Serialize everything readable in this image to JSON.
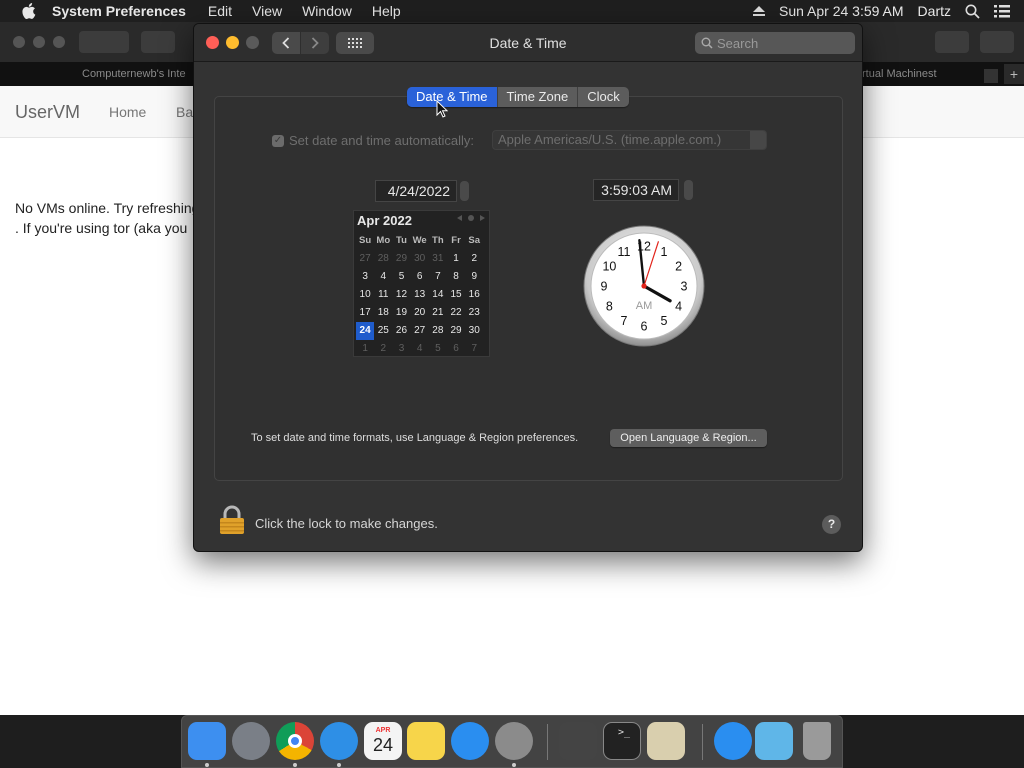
{
  "menubar": {
    "app_name": "System Preferences",
    "menus": [
      "Edit",
      "View",
      "Window",
      "Help"
    ],
    "clock": "Sun Apr 24  3:59 AM",
    "user": "Dartz"
  },
  "browser": {
    "tab_left": "Computernewb's Inte",
    "tab_right": "rtual Machinest",
    "brand": "UserVM",
    "nav_home": "Home",
    "nav_partial": "Ba",
    "message_line1": "No VMs online. Try refreshing",
    "message_line2": ". If you're using tor (aka you"
  },
  "window": {
    "title": "Date & Time",
    "search_placeholder": "Search",
    "tabs": [
      {
        "label": "Date & Time",
        "active": true
      },
      {
        "label": "Time Zone",
        "active": false
      },
      {
        "label": "Clock",
        "active": false
      }
    ],
    "auto_label": "Set date and time automatically:",
    "auto_checked": true,
    "time_server": "Apple Americas/U.S. (time.apple.com.)",
    "date_value": "4/24/2022",
    "time_value": "3:59:03 AM",
    "calendar": {
      "month_label": "Apr 2022",
      "weekdays": [
        "Su",
        "Mo",
        "Tu",
        "We",
        "Th",
        "Fr",
        "Sa"
      ],
      "weeks": [
        [
          [
            "27",
            0
          ],
          [
            "28",
            0
          ],
          [
            "29",
            0
          ],
          [
            "30",
            0
          ],
          [
            "31",
            0
          ],
          [
            "1",
            1
          ],
          [
            "2",
            1
          ]
        ],
        [
          [
            "3",
            1
          ],
          [
            "4",
            1
          ],
          [
            "5",
            1
          ],
          [
            "6",
            1
          ],
          [
            "7",
            1
          ],
          [
            "8",
            1
          ],
          [
            "9",
            1
          ]
        ],
        [
          [
            "10",
            1
          ],
          [
            "11",
            1
          ],
          [
            "12",
            1
          ],
          [
            "13",
            1
          ],
          [
            "14",
            1
          ],
          [
            "15",
            1
          ],
          [
            "16",
            1
          ]
        ],
        [
          [
            "17",
            1
          ],
          [
            "18",
            1
          ],
          [
            "19",
            1
          ],
          [
            "20",
            1
          ],
          [
            "21",
            1
          ],
          [
            "22",
            1
          ],
          [
            "23",
            1
          ]
        ],
        [
          [
            "24",
            2
          ],
          [
            "25",
            1
          ],
          [
            "26",
            1
          ],
          [
            "27",
            1
          ],
          [
            "28",
            1
          ],
          [
            "29",
            1
          ],
          [
            "30",
            1
          ]
        ],
        [
          [
            "1",
            0
          ],
          [
            "2",
            0
          ],
          [
            "3",
            0
          ],
          [
            "4",
            0
          ],
          [
            "5",
            0
          ],
          [
            "6",
            0
          ],
          [
            "7",
            0
          ]
        ]
      ]
    },
    "clock": {
      "hours": 3,
      "minutes": 59,
      "seconds": 3,
      "ampm": "AM",
      "numerals": [
        "12",
        "1",
        "2",
        "3",
        "4",
        "5",
        "6",
        "7",
        "8",
        "9",
        "10",
        "11"
      ]
    },
    "formats_text": "To set date and time formats, use Language & Region preferences.",
    "lang_button": "Open Language & Region...",
    "lock_text": "Click the lock to make changes.",
    "help_label": "?"
  },
  "dock": {
    "calendar_month": "APR",
    "calendar_day": "24",
    "icons": [
      {
        "name": "finder-icon",
        "color": "#3d8ff0",
        "running": true
      },
      {
        "name": "launchpad-icon",
        "color": "#7a7f87",
        "running": false
      },
      {
        "name": "chrome-icon",
        "color": "#e8e8e8",
        "running": true
      },
      {
        "name": "safari-icon",
        "color": "#2e8fe6",
        "running": true
      },
      {
        "name": "calendar-icon",
        "color": "#f4f4f4",
        "running": false
      },
      {
        "name": "notes-icon",
        "color": "#f7d54a",
        "running": false
      },
      {
        "name": "app-store-icon",
        "color": "#2a8ef0",
        "running": false
      },
      {
        "name": "system-preferences-icon",
        "color": "#8b8b8b",
        "running": true
      },
      {
        "name": "network-utility-icon",
        "color": "#444",
        "running": false
      },
      {
        "name": "terminal-icon",
        "color": "#222",
        "running": false
      },
      {
        "name": "mail-stamp-icon",
        "color": "#d9cfae",
        "running": false
      },
      {
        "name": "app-store-downloads-icon",
        "color": "#2a8ef0",
        "running": false
      },
      {
        "name": "downloads-folder-icon",
        "color": "#5fb6e8",
        "running": false
      },
      {
        "name": "trash-icon",
        "color": "#9a9a9a",
        "running": false
      }
    ]
  }
}
